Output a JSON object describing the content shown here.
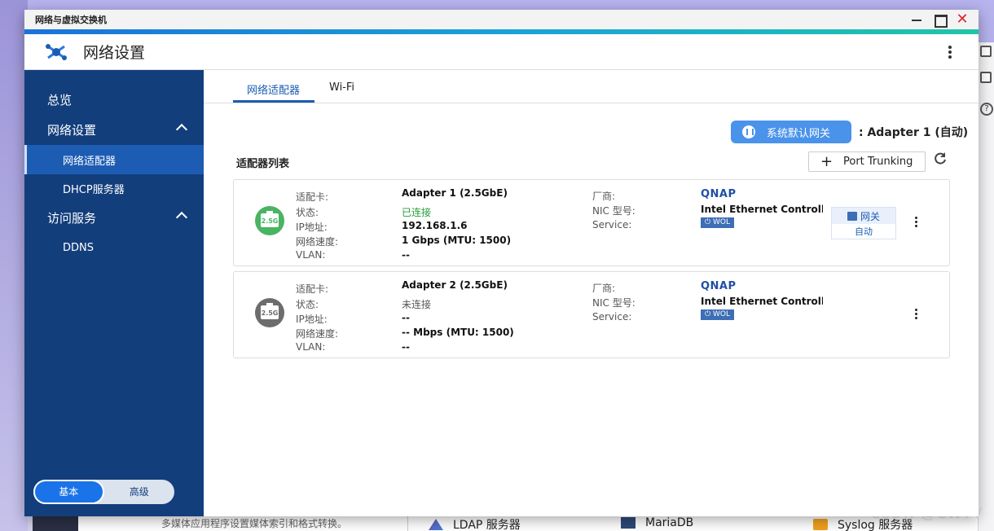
{
  "window": {
    "title": "网络与虚拟交换机",
    "app_title": "网络设置"
  },
  "colors": {
    "accent": "#1a73d9",
    "sidebar": "#133e7c",
    "connected": "#239d3a"
  },
  "sidebar": {
    "items": [
      {
        "label": "总览"
      },
      {
        "label": "网络设置"
      },
      {
        "label": "网络适配器"
      },
      {
        "label": "DHCP服务器"
      },
      {
        "label": "访问服务"
      },
      {
        "label": "DDNS"
      }
    ],
    "mode_toggle": {
      "basic": "基本",
      "advanced": "高级",
      "selected": "基本"
    }
  },
  "tabs": [
    {
      "label": "网络适配器",
      "active": true
    },
    {
      "label": "Wi-Fi",
      "active": false
    }
  ],
  "gateway": {
    "button_label": "系统默认网关",
    "info": ": Adapter 1 (自动)"
  },
  "list": {
    "title": "适配器列表",
    "port_trunking_label": "Port Trunking"
  },
  "labels": {
    "adapter": "适配卡:",
    "status": "状态:",
    "ip": "IP地址:",
    "speed": "网络速度:",
    "vlan": "VLAN:",
    "vendor": "厂商:",
    "nic_model": "NIC 型号:",
    "service": "Service:",
    "wol": "WOL",
    "speed_badge": "2.5G"
  },
  "adapters": [
    {
      "name": "Adapter 1 (2.5GbE)",
      "status": "已连接",
      "ip": "192.168.1.6",
      "speed": "1 Gbps (MTU: 1500)",
      "vlan": "--",
      "vendor": "QNAP",
      "nic": "Intel Ethernet Controller I",
      "gateway_tag": "网关",
      "gateway_mode": "自动"
    },
    {
      "name": "Adapter 2 (2.5GbE)",
      "status": "未连接",
      "ip": "--",
      "speed": "-- Mbps (MTU: 1500)",
      "vlan": "--",
      "vendor": "QNAP",
      "nic": "Intel Ethernet Controller I"
    }
  ],
  "background": {
    "desc": "多媒体应用程序设置媒体索引和格式转换。",
    "items": [
      "LDAP 服务器",
      "MariaDB",
      "Syslog 服务器"
    ],
    "watermark": "CSDN @CWTV"
  }
}
